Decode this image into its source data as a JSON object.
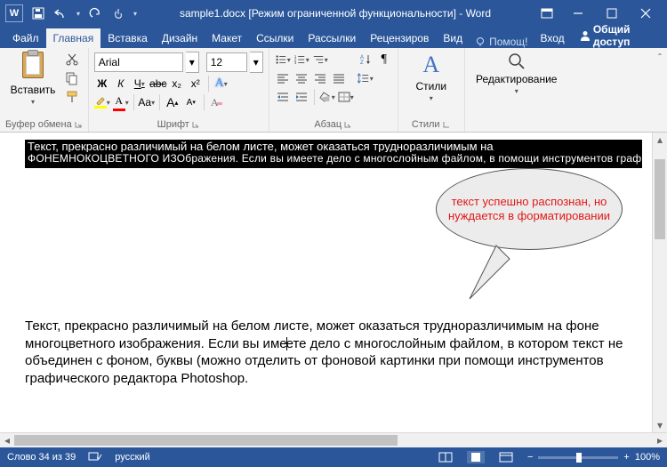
{
  "title": "sample1.docx [Режим ограниченной функциональности] - Word",
  "qat": {
    "save": "save-icon",
    "undo": "undo-icon",
    "redo": "redo-icon",
    "touch": "touch-icon"
  },
  "tabs": {
    "file": "Файл",
    "home": "Главная",
    "insert": "Вставка",
    "design": "Дизайн",
    "layout": "Макет",
    "references": "Ссылки",
    "mailings": "Рассылки",
    "review": "Рецензиров",
    "view": "Вид"
  },
  "tell": "Помощ!",
  "signin": "Вход",
  "share": "Общий доступ",
  "clipboard": {
    "paste": "Вставить",
    "label": "Буфер обмена"
  },
  "font": {
    "name": "Arial",
    "size": "12",
    "label": "Шрифт",
    "bold": "Ж",
    "italic": "К",
    "underline": "Ч",
    "strike": "abc",
    "sub": "x₂",
    "sup": "x²"
  },
  "paragraph": {
    "label": "Абзац"
  },
  "styles": {
    "label": "Стили",
    "btn": "Стили"
  },
  "editing": {
    "label": "Редактирование"
  },
  "doc": {
    "corrupt1": "Текст, прекрасно различимый на белом листе, может оказаться трудноразличимым на",
    "corrupt2": "ФОНЕМНОКОЦВЕТНОГО ИЗОбражения. Если вы имеете дело с многослойным файлом, в помощи инструментов графического редакт Photoshop                                     отделить от фоновой картинки при",
    "callout": "текст успешно распознан, но нуждается в форматировании",
    "body": "Текст, прекрасно различимый на белом листе, может оказаться трудноразличимым на фоне многоцветного изображения. Если вы име|ете дело с многослойным файлом, в котором текст не объединен с фоном, буквы (можно отделить от фоновой картинки при помощи инструментов графического редактора Photoshop."
  },
  "status": {
    "words": "Слово 34 из 39",
    "lang": "русский",
    "zoom": "100%"
  }
}
